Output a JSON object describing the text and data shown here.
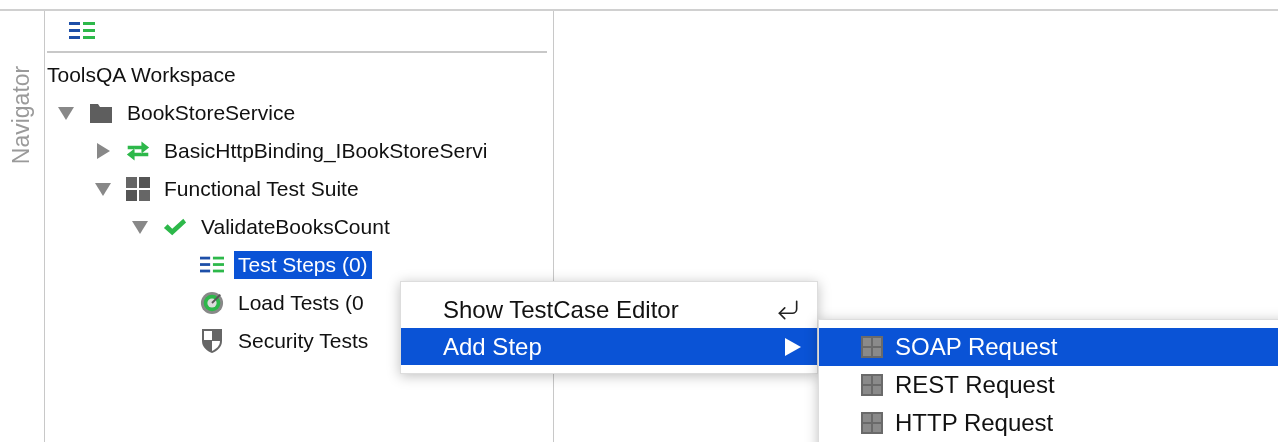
{
  "side_tab": {
    "label": "Navigator"
  },
  "tree": {
    "root": "ToolsQA Workspace",
    "items": [
      {
        "label": "BookStoreService",
        "kind": "folder",
        "expanded": true,
        "selected": false,
        "children": [
          {
            "label": "BasicHttpBinding_IBookStoreServi",
            "kind": "interface",
            "expanded": false,
            "selected": false
          },
          {
            "label": "Functional Test Suite",
            "kind": "suite",
            "expanded": true,
            "selected": false,
            "children": [
              {
                "label": "ValidateBooksCount",
                "kind": "testcase",
                "expanded": true,
                "selected": false,
                "children": [
                  {
                    "label": "Test Steps (0)",
                    "kind": "steps",
                    "selected": true
                  },
                  {
                    "label": "Load Tests (0",
                    "kind": "load",
                    "selected": false
                  },
                  {
                    "label": "Security Tests",
                    "kind": "security",
                    "selected": false
                  }
                ]
              }
            ]
          }
        ]
      }
    ]
  },
  "context_menu": {
    "items": [
      {
        "label": "Show TestCase Editor",
        "kind": "action",
        "selected": false
      },
      {
        "label": "Add Step",
        "kind": "submenu",
        "selected": true
      }
    ]
  },
  "submenu": {
    "items": [
      {
        "label": "SOAP Request",
        "selected": true
      },
      {
        "label": "REST Request",
        "selected": false
      },
      {
        "label": "HTTP Request",
        "selected": false
      }
    ]
  }
}
